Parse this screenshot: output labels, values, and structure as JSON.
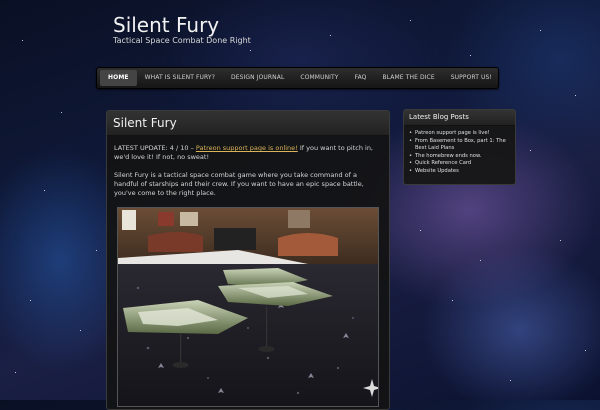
{
  "site": {
    "title": "Silent Fury",
    "description": "Tactical Space Combat Done Right"
  },
  "nav": {
    "items": [
      {
        "label": "HOME",
        "active": true
      },
      {
        "label": "WHAT IS SILENT FURY?",
        "active": false
      },
      {
        "label": "DESIGN JOURNAL",
        "active": false
      },
      {
        "label": "COMMUNITY",
        "active": false
      },
      {
        "label": "FAQ",
        "active": false
      },
      {
        "label": "BLAME THE DICE",
        "active": false
      },
      {
        "label": "SUPPORT US!",
        "active": false
      }
    ]
  },
  "post": {
    "title": "Silent Fury",
    "update_prefix": "LATEST UPDATE: 4 / 10 – ",
    "update_link": "Patreon support page is online!",
    "update_suffix": "  If you want to pitch in, we'd love it!  If not, no sweat!",
    "intro": "Silent Fury is a tactical space combat game where you take command of a handful of starships and their crew.  If you want to have an epic space battle, you've come to the right place."
  },
  "sidebar": {
    "title": "Latest Blog Posts",
    "items": [
      {
        "label": "Patreon support page is live!"
      },
      {
        "label": "From Basement to Box, part 1: The Best Laid Plans"
      },
      {
        "label": "The homebrew ends now."
      },
      {
        "label": "Quick Reference Card"
      },
      {
        "label": "Website Updates"
      }
    ]
  },
  "colors": {
    "link": "#d9b45a",
    "nav_active_bg": "#444444",
    "panel_bg": "#141414"
  }
}
